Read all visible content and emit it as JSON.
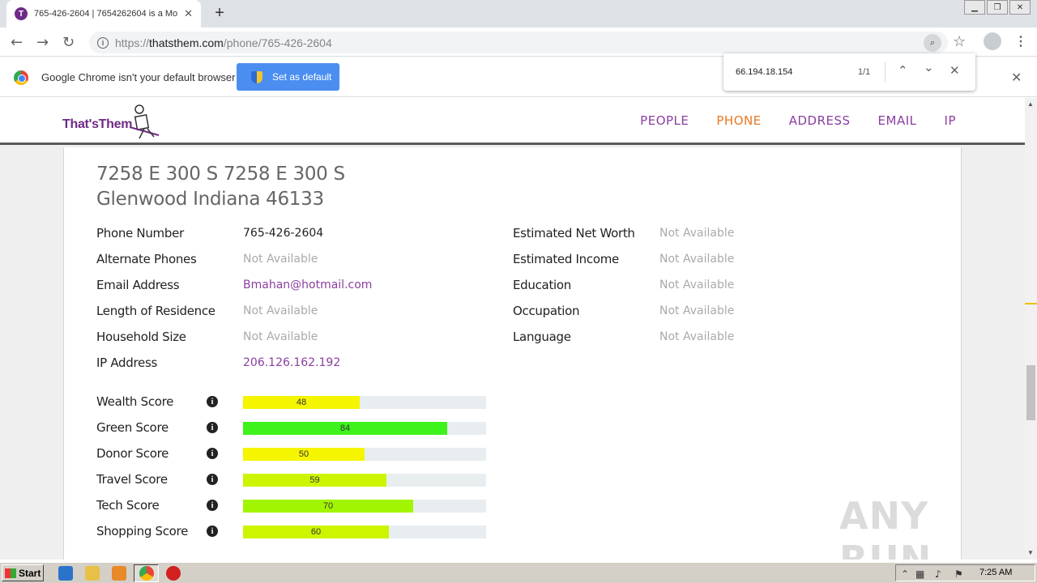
{
  "browser": {
    "tab_title": "765-426-2604 | 7654262604 is a Mo",
    "tab_favicon": "T",
    "url_host": "thatsthem.com",
    "url_scheme": "https://",
    "url_path": "/phone/765-426-2604"
  },
  "infobar": {
    "message": "Google Chrome isn't your default browser",
    "button_label": "Set as default"
  },
  "findbar": {
    "query": "66.194.18.154",
    "count": "1/1"
  },
  "site": {
    "logo": "That'sThem",
    "nav": [
      "PEOPLE",
      "PHONE",
      "ADDRESS",
      "EMAIL",
      "IP"
    ],
    "active_nav": "PHONE",
    "accent_color": "#8a3fa0",
    "active_color": "#e87722"
  },
  "record": {
    "address_line1": "7258 E 300 S 7258 E 300 S",
    "address_line2": "Glenwood Indiana 46133",
    "left_fields": [
      {
        "label": "Phone Number",
        "value": "765-426-2604",
        "style": "plain"
      },
      {
        "label": "Alternate Phones",
        "value": "Not Available",
        "style": "na"
      },
      {
        "label": "Email Address",
        "value": "Bmahan@hotmail.com",
        "style": "link"
      },
      {
        "label": "Length of Residence",
        "value": "Not Available",
        "style": "na"
      },
      {
        "label": "Household Size",
        "value": "Not Available",
        "style": "na"
      },
      {
        "label": "IP Address",
        "value": "206.126.162.192",
        "style": "link"
      }
    ],
    "right_fields": [
      {
        "label": "Estimated Net Worth",
        "value": "Not Available"
      },
      {
        "label": "Estimated Income",
        "value": "Not Available"
      },
      {
        "label": "Education",
        "value": "Not Available"
      },
      {
        "label": "Occupation",
        "value": "Not Available"
      },
      {
        "label": "Language",
        "value": "Not Available"
      }
    ],
    "scores": [
      {
        "label": "Wealth Score",
        "value": 48,
        "color": "#f5f500"
      },
      {
        "label": "Green Score",
        "value": 84,
        "color": "#3ef21c"
      },
      {
        "label": "Donor Score",
        "value": 50,
        "color": "#f5f500"
      },
      {
        "label": "Travel Score",
        "value": 59,
        "color": "#cdf500"
      },
      {
        "label": "Tech Score",
        "value": 70,
        "color": "#a2f500"
      },
      {
        "label": "Shopping Score",
        "value": 60,
        "color": "#cdf500"
      }
    ],
    "info_glyph": "i"
  },
  "watermark": "ANY RUN",
  "taskbar": {
    "start_label": "Start",
    "clock": "7:25 AM"
  }
}
